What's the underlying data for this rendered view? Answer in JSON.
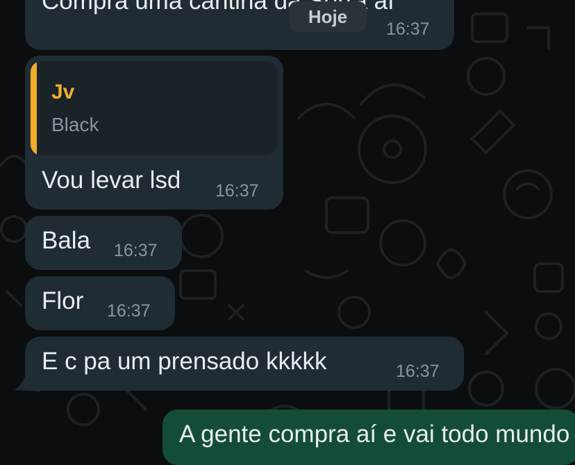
{
  "date_chip": "Hoje",
  "messages": [
    {
      "text": "Compra uma cantina da Serra aí",
      "time": "16:37"
    },
    {
      "quote_author": "Jv",
      "quote_text": "Black",
      "text": "Vou levar lsd",
      "time": "16:37"
    },
    {
      "text": "Bala",
      "time": "16:37"
    },
    {
      "text": "Flor",
      "time": "16:37"
    },
    {
      "text": "E c pa um prensado kkkkk",
      "time": "16:37"
    },
    {
      "text": "A gente compra aí e vai todo mundo",
      "time": ""
    }
  ],
  "colors": {
    "incoming_bubble": "#202c33",
    "outgoing_bubble": "#144d37",
    "quote_accent": "#f0ad2c",
    "timestamp": "#8696a0",
    "background": "#0b0d0e"
  }
}
